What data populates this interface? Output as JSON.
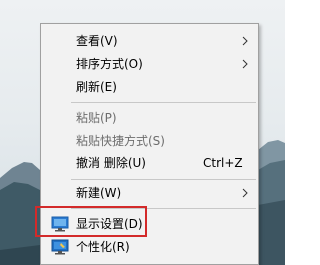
{
  "context_menu": {
    "items": [
      {
        "label": "查看(V)"
      },
      {
        "label": "排序方式(O)"
      },
      {
        "label": "刷新(E)"
      },
      {
        "label": "粘贴(P)"
      },
      {
        "label": "粘贴快捷方式(S)"
      },
      {
        "label": "撤消 删除(U)",
        "shortcut": "Ctrl+Z"
      },
      {
        "label": "新建(W)"
      },
      {
        "label": "显示设置(D)",
        "icon": "display-icon"
      },
      {
        "label": "个性化(R)",
        "icon": "personalize-icon"
      }
    ]
  },
  "colors": {
    "menu_background": "#f2f2f2",
    "disabled_text": "#6d6d6d",
    "highlight_border": "#d32a2a"
  }
}
